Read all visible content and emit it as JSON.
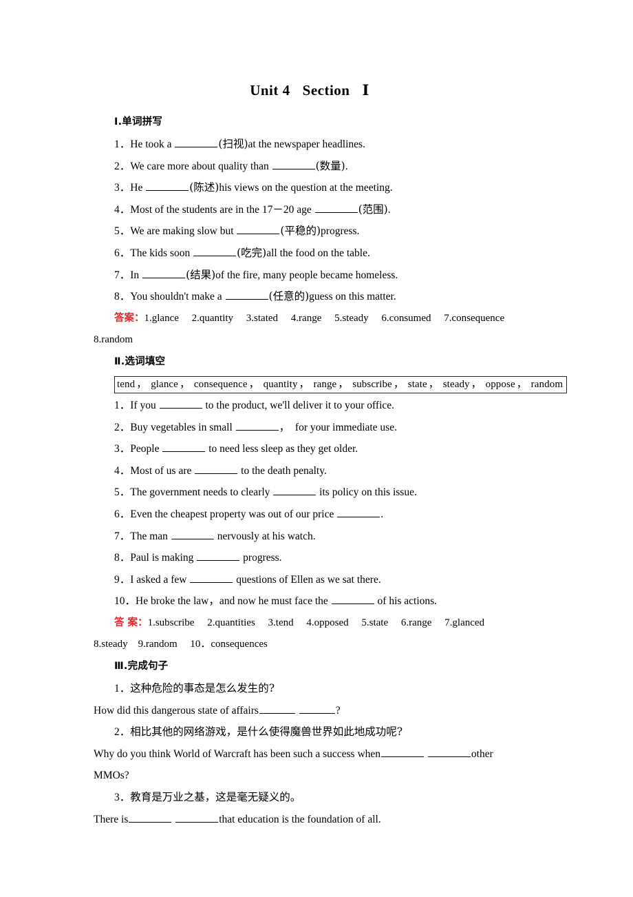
{
  "document": {
    "title_main": "Unit 4",
    "title_sub": "Section",
    "title_numeral": "Ⅰ"
  },
  "colors": {
    "answer_label": "#e8262c",
    "text": "#000000",
    "page_background": "#ffffff",
    "box_border": "#222222"
  },
  "sections": [
    {
      "heading": "Ⅰ.单词拼写",
      "questions": [
        {
          "num": "1．",
          "pre": "He took a ",
          "hint": "(扫视)",
          "post": "at the newspaper headlines."
        },
        {
          "num": "2．",
          "pre": "We care more about quality than ",
          "hint": "(数量)",
          "post": "."
        },
        {
          "num": "3．",
          "pre": "He ",
          "hint": "(陈述)",
          "post": "his views on the question at the meeting."
        },
        {
          "num": "4．",
          "pre": "Most of the students are in the 17－20 age ",
          "hint": "(范围)",
          "post": "."
        },
        {
          "num": "5．",
          "pre": "We are making slow but ",
          "hint": "(平稳的)",
          "post": "progress."
        },
        {
          "num": "6．",
          "pre": "The kids soon ",
          "hint": "(吃完)",
          "post": "all the food on the table."
        },
        {
          "num": "7．",
          "pre": "In ",
          "hint": "(结果)",
          "post": "of the fire, many people became homeless."
        },
        {
          "num": "8．",
          "pre": "You shouldn't make a ",
          "hint": "(任意的)",
          "post": "guess on this matter."
        }
      ],
      "answer_label": "答案：",
      "answer_line1": "1.glance　 2.quantity　 3.stated　 4.range　 5.steady　 6.consumed　 7.consequence",
      "answer_line2": "8.random"
    },
    {
      "heading": "Ⅱ.选词填空",
      "wordbank": [
        "tend",
        "glance",
        "consequence",
        "quantity",
        "range",
        "subscribe",
        "state",
        "steady",
        "oppose",
        "random"
      ],
      "wordbank_separator": "，",
      "questions": [
        {
          "num": "1．",
          "pre": "If you ",
          "post": " to the product, we'll deliver it to your office."
        },
        {
          "num": "2．",
          "pre": "Buy vegetables in small ",
          "post": "，  for your immediate use."
        },
        {
          "num": "3．",
          "pre": "People ",
          "post": " to need less sleep as they get older."
        },
        {
          "num": "4．",
          "pre": "Most of us are ",
          "post": " to the death penalty."
        },
        {
          "num": "5．",
          "pre": "The government needs to clearly ",
          "post": " its policy on this issue."
        },
        {
          "num": "6．",
          "pre": "Even the cheapest property was out of our price ",
          "post": "."
        },
        {
          "num": "7．",
          "pre": "The man ",
          "post": " nervously at his watch."
        },
        {
          "num": "8．",
          "pre": "Paul is making ",
          "post": " progress."
        },
        {
          "num": "9．",
          "pre": "I asked a few ",
          "post": " questions of Ellen as we sat there."
        },
        {
          "num": "10．",
          "pre": "He broke the law，and now he must face the ",
          "post": " of his actions."
        }
      ],
      "answer_label": "答 案：",
      "answer_line1": "1.subscribe　 2.quantities　 3.tend　 4.opposed　 5.state　 6.range　 7.glanced",
      "answer_line2": "8.steady　9.random　 10．consequences"
    },
    {
      "heading": "Ⅲ.完成句子",
      "items": [
        {
          "num": "1．",
          "chinese": "这种危险的事态是怎么发生的?",
          "english_pre": "How did this dangerous state of affairs",
          "english_mid": " ",
          "english_post": "?",
          "english_tail": ""
        },
        {
          "num": "2．",
          "chinese": "相比其他的网络游戏，是什么使得魔兽世界如此地成功呢?",
          "english_pre": "Why do you think World of Warcraft has been such a success when",
          "english_mid": " ",
          "english_post": "other",
          "english_tail": "MMOs?"
        },
        {
          "num": "3．",
          "chinese": "教育是万业之基，这是毫无疑义的。",
          "english_pre": "There is",
          "english_mid": " ",
          "english_post": "that education is the foundation of all.",
          "english_tail": ""
        }
      ]
    }
  ]
}
